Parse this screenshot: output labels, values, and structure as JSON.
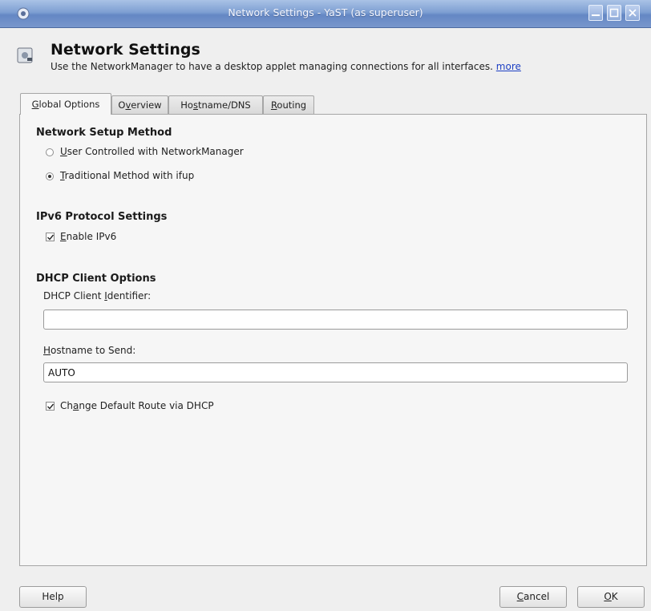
{
  "window": {
    "title": "Network Settings - YaST (as superuser)",
    "icon": "yast-icon",
    "controls": [
      "minimize-icon",
      "maximize-icon",
      "close-icon"
    ]
  },
  "header": {
    "title": "Network Settings",
    "description": "Use the NetworkManager to have a desktop applet managing connections for all interfaces.",
    "more_link": "more",
    "icon": "network-card-icon"
  },
  "tabs": [
    {
      "label": "Global Options",
      "mnemonic": "G",
      "rest": "lobal Options",
      "active": true
    },
    {
      "label": "Overview",
      "mnemonic": "v",
      "pre": "O",
      "rest": "erview",
      "active": false
    },
    {
      "label": "Hostname/DNS",
      "pre": "Ho",
      "mnemonic": "s",
      "rest": "tname/DNS",
      "active": false
    },
    {
      "label": "Routing",
      "mnemonic": "R",
      "rest": "outing",
      "active": false
    }
  ],
  "setup_method": {
    "title": "Network Setup Method",
    "options": [
      {
        "label": "User Controlled with NetworkManager",
        "mnemonic": "U",
        "rest": "ser Controlled with NetworkManager",
        "selected": false
      },
      {
        "label": "Traditional Method with ifup",
        "mnemonic": "T",
        "rest": "raditional Method with ifup",
        "selected": true
      }
    ]
  },
  "ipv6": {
    "title": "IPv6 Protocol Settings",
    "enable": {
      "label": "Enable IPv6",
      "mnemonic": "E",
      "rest": "nable IPv6",
      "checked": true
    }
  },
  "dhcp": {
    "title": "DHCP Client Options",
    "identifier": {
      "label_pre": "DHCP Client ",
      "mnemonic": "I",
      "label_rest": "dentifier:",
      "value": ""
    },
    "hostname": {
      "mnemonic": "H",
      "label_rest": "ostname to Send:",
      "value": "AUTO"
    },
    "default_route": {
      "pre": "Ch",
      "mnemonic": "a",
      "rest": "nge Default Route via DHCP",
      "checked": true
    }
  },
  "buttons": {
    "help": "Help",
    "cancel": {
      "mnemonic": "C",
      "rest": "ancel"
    },
    "ok": {
      "mnemonic": "O",
      "rest": "K"
    }
  },
  "colors": {
    "titlebar": "#7e9fd2",
    "link": "#1c3fc4",
    "panel": "#f6f6f6"
  }
}
